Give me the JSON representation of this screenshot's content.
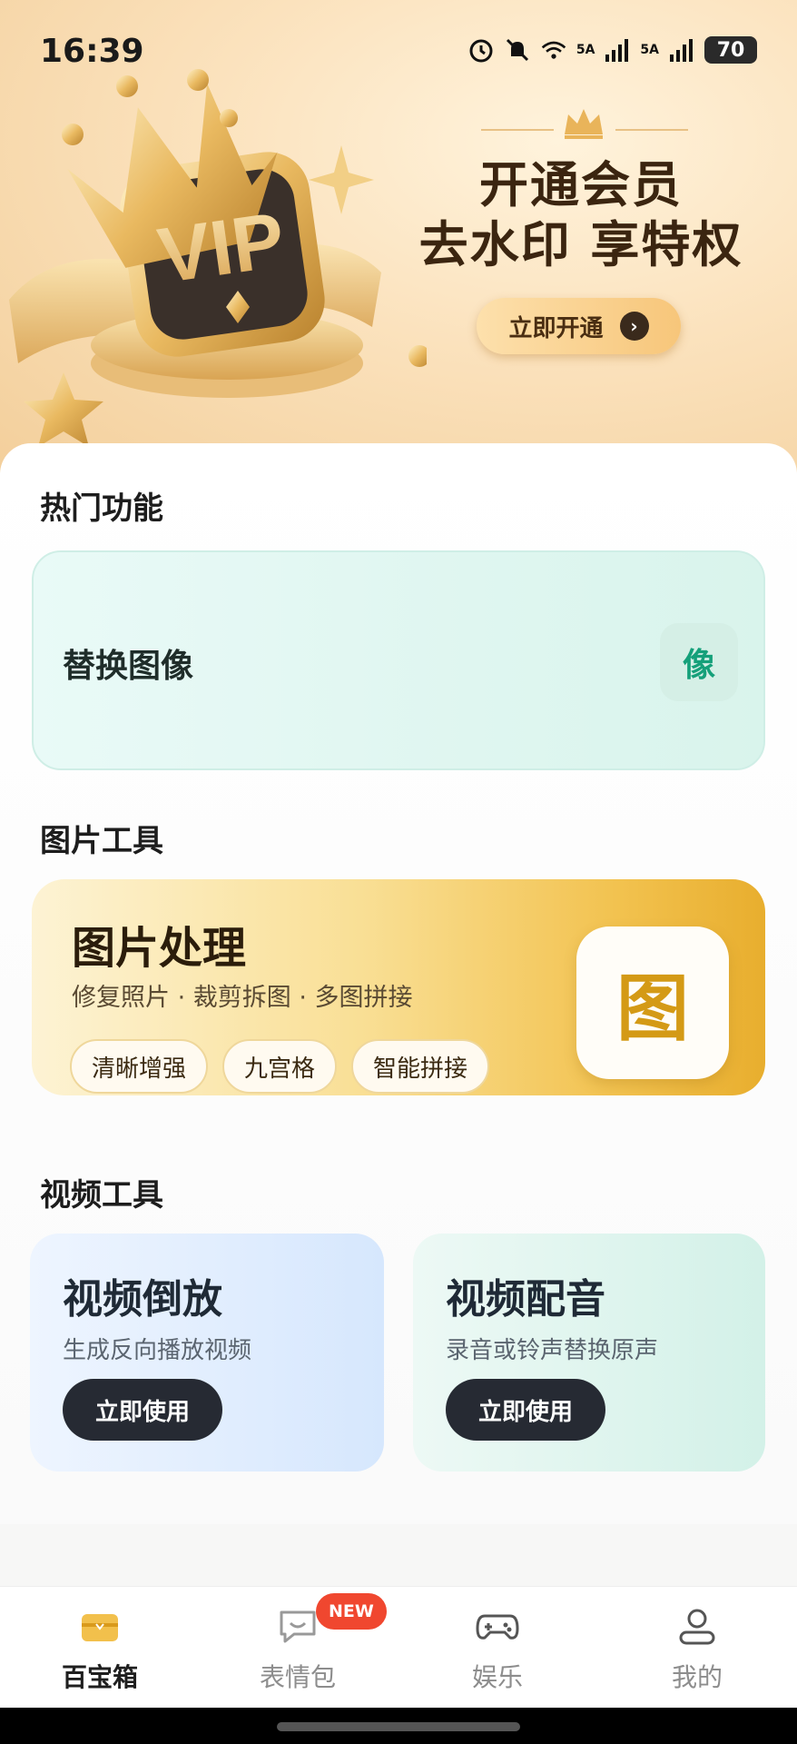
{
  "status_bar": {
    "time": "16:39",
    "signal1": "5A",
    "signal2": "5A",
    "battery": "70",
    "icons": [
      "alarm-icon",
      "bell-mute-icon",
      "wifi-icon",
      "signal-icon",
      "signal-icon",
      "battery-icon"
    ]
  },
  "banner": {
    "line1": "开通会员",
    "line2": "去水印 享特权",
    "button": "立即开通",
    "vip_text": "VIP"
  },
  "hot_section": {
    "title": "热门功能",
    "card_title": "替换图像",
    "card_icon_text": "像"
  },
  "image_tools": {
    "title": "图片工具",
    "card_title": "图片处理",
    "card_sub": "修复照片 · 裁剪拆图 · 多图拼接",
    "chips": [
      "清晰增强",
      "九宫格",
      "智能拼接"
    ],
    "icon_text": "图"
  },
  "video_tools": {
    "title": "视频工具",
    "cards": [
      {
        "title": "视频倒放",
        "sub": "生成反向播放视频",
        "button": "立即使用"
      },
      {
        "title": "视频配音",
        "sub": "录音或铃声替换原声",
        "button": "立即使用"
      }
    ]
  },
  "bottom_nav": {
    "items": [
      {
        "label": "百宝箱",
        "icon": "toolbox-icon",
        "active": true
      },
      {
        "label": "表情包",
        "icon": "sticker-chat-icon",
        "active": false
      },
      {
        "label": "娱乐",
        "icon": "gamepad-icon",
        "active": false
      },
      {
        "label": "我的",
        "icon": "user-icon",
        "active": false
      }
    ],
    "badge": "NEW"
  },
  "colors": {
    "accent_green": "#15a07a",
    "accent_gold": "#d49a16",
    "dark_button": "#262a33",
    "badge_red": "#f0472f"
  }
}
